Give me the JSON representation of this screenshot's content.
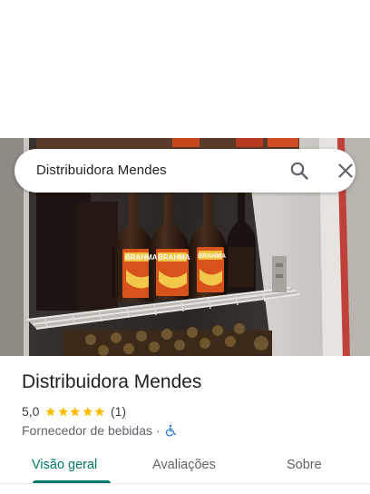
{
  "search": {
    "query": "Distribuidora Mendes",
    "search_icon": "search-icon",
    "close_icon": "close-icon"
  },
  "photo": {
    "bottle_label_text": [
      "BRAHMA",
      "BRAHMA",
      "BRAHMA"
    ]
  },
  "place": {
    "name": "Distribuidora Mendes",
    "rating": "5,0",
    "stars": 5,
    "review_count": "(1)",
    "category": "Fornecedor de bebidas",
    "separator": "·",
    "accessibility_icon": "wheelchair-icon"
  },
  "tabs": [
    {
      "label": "Visão geral",
      "active": true
    },
    {
      "label": "Avaliações",
      "active": false
    },
    {
      "label": "Sobre",
      "active": false
    }
  ],
  "colors": {
    "accent": "#00796b",
    "star": "#fbbc04",
    "text_primary": "#202124",
    "text_secondary": "#5f6368",
    "accessibility_blue": "#1a73e8"
  }
}
